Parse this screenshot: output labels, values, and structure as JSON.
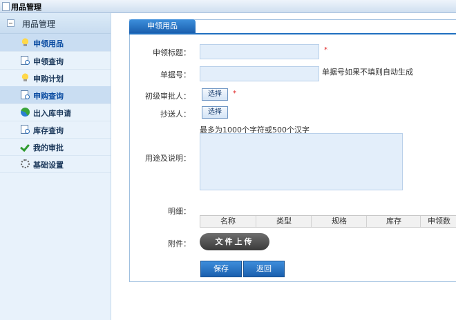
{
  "window": {
    "title": "用品管理"
  },
  "sidebar": {
    "header": "用品管理",
    "items": [
      {
        "label": "申领用品",
        "icon": "lightbulb-icon",
        "active": true
      },
      {
        "label": "申领查询",
        "icon": "document-search-icon",
        "active": false
      },
      {
        "label": "申购计划",
        "icon": "lightbulb-icon",
        "active": false
      },
      {
        "label": "申购查询",
        "icon": "document-search-icon",
        "active": true
      },
      {
        "label": "出入库申请",
        "icon": "cycle-icon",
        "active": false
      },
      {
        "label": "库存查询",
        "icon": "document-search-icon",
        "active": false
      },
      {
        "label": "我的审批",
        "icon": "checkmark-icon",
        "active": false
      },
      {
        "label": "基础设置",
        "icon": "gear-icon",
        "active": false
      }
    ]
  },
  "tab": {
    "label": "申领用品"
  },
  "form": {
    "title_label": "申领标题：",
    "title_value": "",
    "title_required": "*",
    "doc_no_label": "单据号：",
    "doc_no_value": "",
    "doc_no_hint": "单据号如果不填则自动生成",
    "approver_label": "初级审批人：",
    "approver_button": "选择",
    "approver_required": "*",
    "cc_label": "抄送人：",
    "cc_button": "选择",
    "purpose_hint": "最多为1000个字符或500个汉字",
    "purpose_label": "用途及说明：",
    "purpose_value": "",
    "detail_label": "明细：",
    "detail_columns": [
      "名称",
      "类型",
      "规格",
      "库存",
      "申领数"
    ],
    "attachment_label": "附件：",
    "upload_button": "文件上传",
    "save_button": "保存",
    "back_button": "返回"
  }
}
